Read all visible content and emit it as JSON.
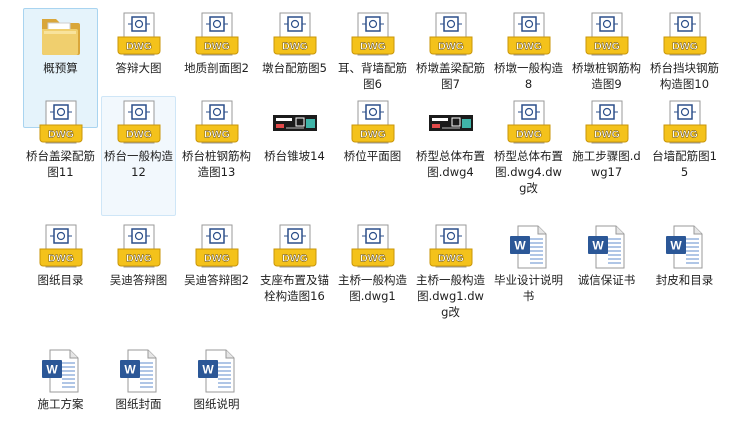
{
  "window": {
    "title": ""
  },
  "files": [
    {
      "name": "概预算",
      "type": "folder"
    },
    {
      "name": "答辩大图",
      "type": "dwg"
    },
    {
      "name": "地质剖面图2",
      "type": "dwg"
    },
    {
      "name": "墩台配筋图5",
      "type": "dwg"
    },
    {
      "name": "耳、背墙配筋图6",
      "type": "dwg"
    },
    {
      "name": "桥墩盖梁配筋图7",
      "type": "dwg"
    },
    {
      "name": "桥墩一般构造8",
      "type": "dwg"
    },
    {
      "name": "桥墩桩钢筋构造图9",
      "type": "dwg"
    },
    {
      "name": "桥台挡块钢筋构造图10",
      "type": "dwg"
    },
    {
      "name": "桥台盖梁配筋图11",
      "type": "dwg"
    },
    {
      "name": "桥台一般构造12",
      "type": "dwg",
      "hover": true
    },
    {
      "name": "桥台桩钢筋构造图13",
      "type": "dwg"
    },
    {
      "name": "桥台锥坡14",
      "type": "dwg-thumb"
    },
    {
      "name": "桥位平面图",
      "type": "dwg"
    },
    {
      "name": "桥型总体布置图.dwg4",
      "type": "dwg-thumb"
    },
    {
      "name": "桥型总体布置图.dwg4.dwg改",
      "type": "dwg"
    },
    {
      "name": "施工步骤图.dwg17",
      "type": "dwg"
    },
    {
      "name": "台墙配筋图15",
      "type": "dwg"
    },
    {
      "name": "图纸目录",
      "type": "dwg"
    },
    {
      "name": "吴迪答辩图",
      "type": "dwg"
    },
    {
      "name": "吴迪答辩图2",
      "type": "dwg"
    },
    {
      "name": "支座布置及锚栓构造图16",
      "type": "dwg"
    },
    {
      "name": "主桥一般构造图.dwg1",
      "type": "dwg"
    },
    {
      "name": "主桥一般构造图.dwg1.dwg改",
      "type": "dwg"
    },
    {
      "name": "毕业设计说明书",
      "type": "word"
    },
    {
      "name": "诚信保证书",
      "type": "word"
    },
    {
      "name": "封皮和目录",
      "type": "word"
    },
    {
      "name": "施工方案",
      "type": "word"
    },
    {
      "name": "图纸封面",
      "type": "word"
    },
    {
      "name": "图纸说明",
      "type": "word"
    }
  ],
  "selected_index": 0,
  "icon_text": {
    "dwg": "DWG",
    "word": "W"
  },
  "colors": {
    "selection_bg": "#e5f3fb",
    "selection_border": "#a9d4f0",
    "dwg_yellow": "#f4c21b",
    "word_blue": "#2b5797"
  }
}
